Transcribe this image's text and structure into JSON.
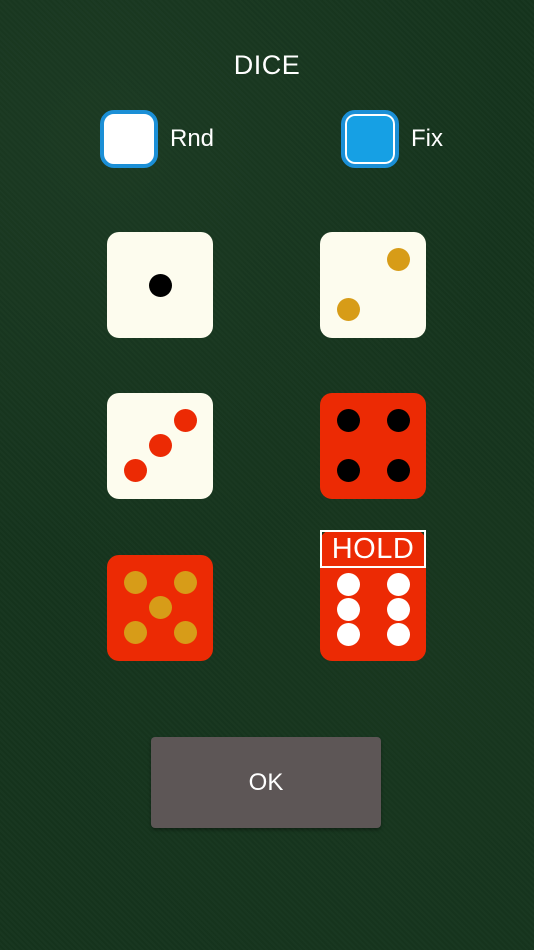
{
  "title": "DICE",
  "mode": {
    "rnd_label": "Rnd",
    "fix_label": "Fix",
    "selected": "Fix"
  },
  "dice": [
    {
      "value": 1,
      "face": "cream",
      "pip_color": "black",
      "held": false
    },
    {
      "value": 2,
      "face": "cream",
      "pip_color": "gold",
      "held": false
    },
    {
      "value": 3,
      "face": "cream",
      "pip_color": "red",
      "held": false
    },
    {
      "value": 4,
      "face": "red",
      "pip_color": "black",
      "held": false
    },
    {
      "value": 5,
      "face": "red",
      "pip_color": "gold",
      "held": false
    },
    {
      "value": 6,
      "face": "red",
      "pip_color": "white",
      "held": true,
      "hold_label": "HOLD"
    }
  ],
  "colors": {
    "cream": "#fdfcee",
    "red": "#ec2a04",
    "black": "#000000",
    "gold": "#d79c18",
    "white": "#ffffff",
    "checkbox_border": "#1b8fd6",
    "checkbox_fill": "#16a0e4",
    "button": "#5d5656"
  },
  "ok_label": "OK"
}
